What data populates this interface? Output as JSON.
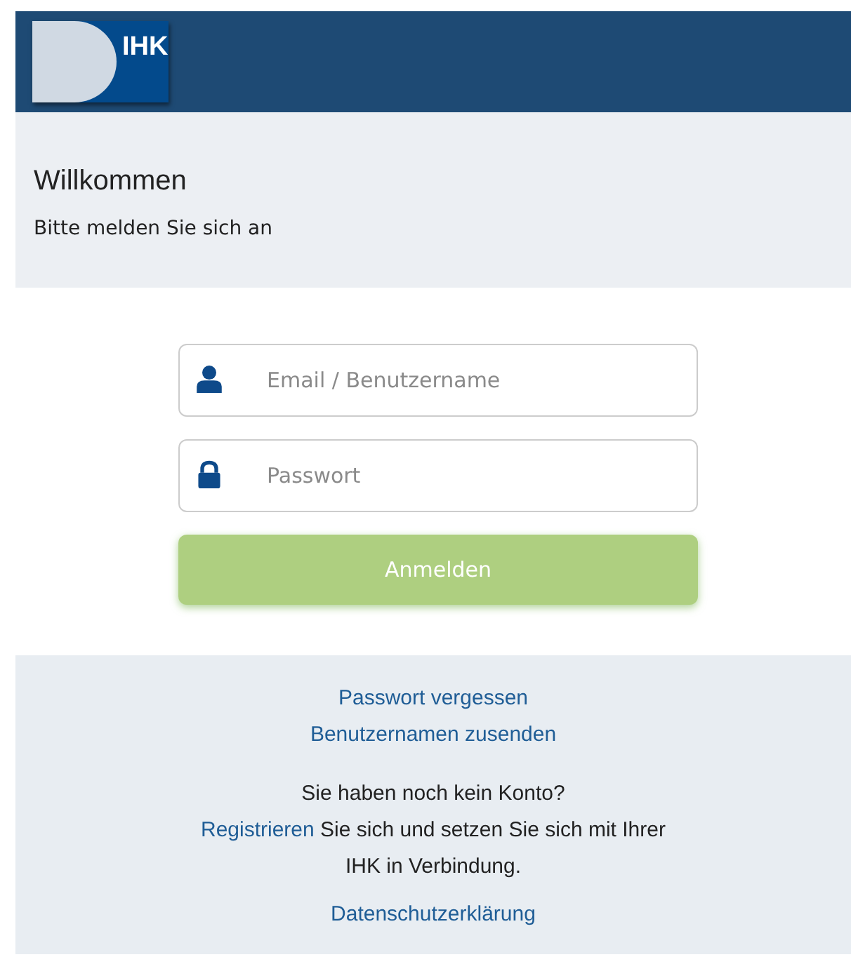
{
  "header": {
    "logo": "IHK"
  },
  "welcome": {
    "title": "Willkommen",
    "subtitle": "Bitte melden Sie sich an"
  },
  "form": {
    "fields": [
      {
        "kind": "user",
        "placeholder": "Email / Benutzername"
      },
      {
        "kind": "lock",
        "placeholder": "Passwort"
      }
    ],
    "submit": {
      "label": "Anmelden",
      "disabled": true
    }
  },
  "footer": {
    "links": [
      "Passwort vergessen",
      "Benutzernamen zusenden"
    ],
    "question": "Sie haben noch kein Konto?",
    "register": {
      "link": "Registrieren",
      "text": "Sie sich und setzen Sie sich mit Ihrer IHK in Verbindung."
    },
    "privacy": "Datenschutzerklärung"
  }
}
